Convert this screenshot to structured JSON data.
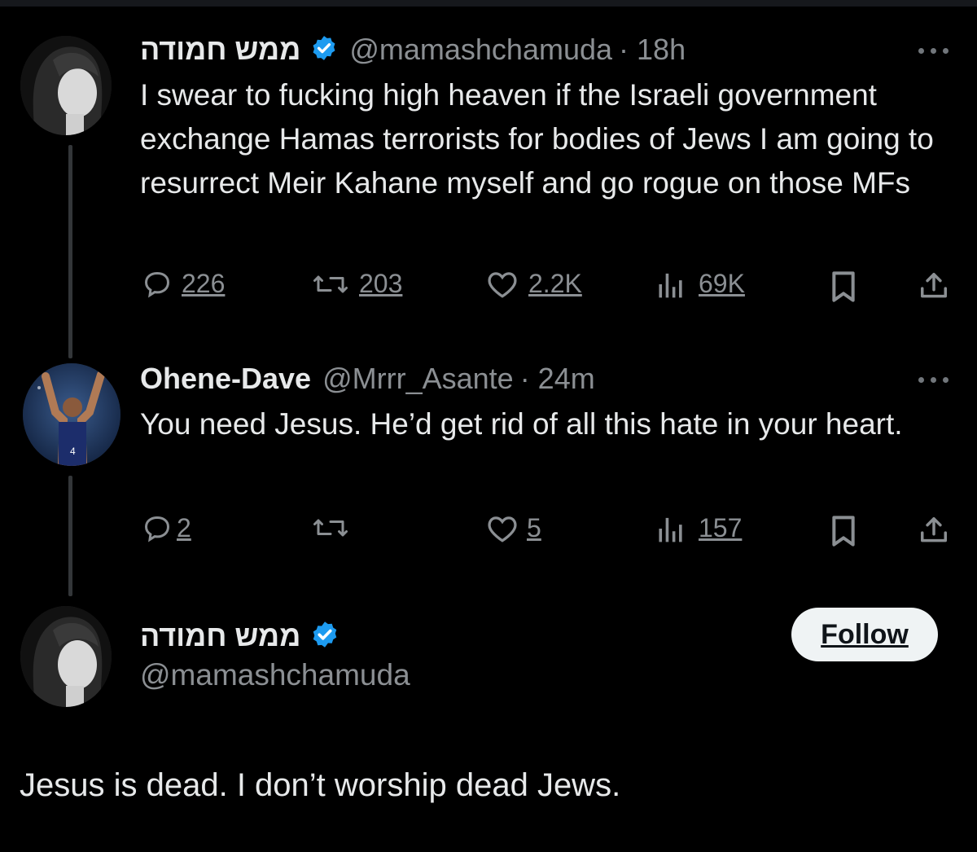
{
  "tweets": [
    {
      "display_name": "ממש חמודה",
      "verified": true,
      "handle": "@mamashchamuda",
      "time": "· 18h",
      "text": "I swear to fucking high heaven if the Israeli government exchange Hamas terrorists for bodies of Jews I am going to resurrect Meir Kahane myself and go rogue on those MFs",
      "replies": "226",
      "reposts": "203",
      "likes": "2.2K",
      "views": "69K"
    },
    {
      "display_name": "Ohene-Dave",
      "verified": false,
      "handle": "@Mrrr_Asante",
      "time": "· 24m",
      "text": "You need Jesus. He’d get rid of all this hate in your heart.",
      "replies": "2",
      "reposts": "",
      "likes": "5",
      "views": "157"
    }
  ],
  "reply": {
    "display_name": "ממש חמודה",
    "verified": true,
    "handle": "@mamashchamuda",
    "follow_label": "Follow",
    "text": "Jesus is dead. I don’t worship dead Jews."
  },
  "icons": {
    "reply": "speech-bubble-icon",
    "repost": "repost-arrows-icon",
    "like": "heart-icon",
    "views": "bar-chart-icon",
    "bookmark": "bookmark-icon",
    "share": "share-upload-icon",
    "more": "more-dots-icon",
    "verified": "verified-badge-icon"
  },
  "colors": {
    "background": "#000000",
    "text": "#e7e9ea",
    "muted": "#8b8f93",
    "verified": "#1d9bf0",
    "follow_bg": "#eff3f4"
  }
}
